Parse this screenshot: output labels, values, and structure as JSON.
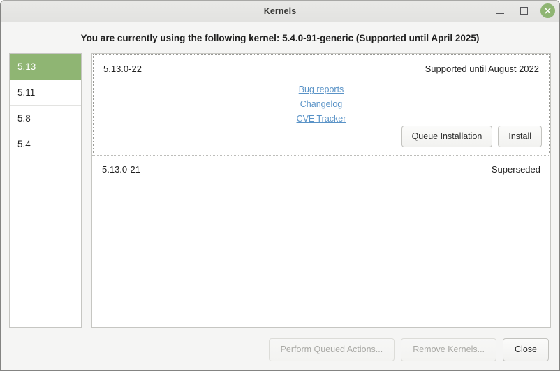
{
  "window": {
    "title": "Kernels",
    "controls": {
      "minimize": "minimize-icon",
      "maximize": "maximize-icon",
      "close": "close-icon"
    },
    "accent_color": "#8fb573",
    "link_color": "#5a93c7"
  },
  "heading": {
    "text": "You are currently using the following kernel: 5.4.0-91-generic (Supported until April 2025)"
  },
  "sidebar": {
    "items": [
      {
        "label": "5.13",
        "selected": true
      },
      {
        "label": "5.11",
        "selected": false
      },
      {
        "label": "5.8",
        "selected": false
      },
      {
        "label": "5.4",
        "selected": false
      }
    ]
  },
  "kernel_list": {
    "rows": [
      {
        "version": "5.13.0-22",
        "status": "Supported until August 2022",
        "expanded": true,
        "links": [
          {
            "label": "Bug reports"
          },
          {
            "label": "Changelog"
          },
          {
            "label": "CVE Tracker"
          }
        ],
        "buttons": [
          {
            "label": "Queue Installation",
            "disabled": false
          },
          {
            "label": "Install",
            "disabled": false
          }
        ]
      },
      {
        "version": "5.13.0-21",
        "status": "Superseded",
        "expanded": false
      }
    ]
  },
  "footer": {
    "buttons": [
      {
        "label": "Perform Queued Actions...",
        "disabled": true
      },
      {
        "label": "Remove Kernels...",
        "disabled": true
      },
      {
        "label": "Close",
        "disabled": false
      }
    ]
  }
}
